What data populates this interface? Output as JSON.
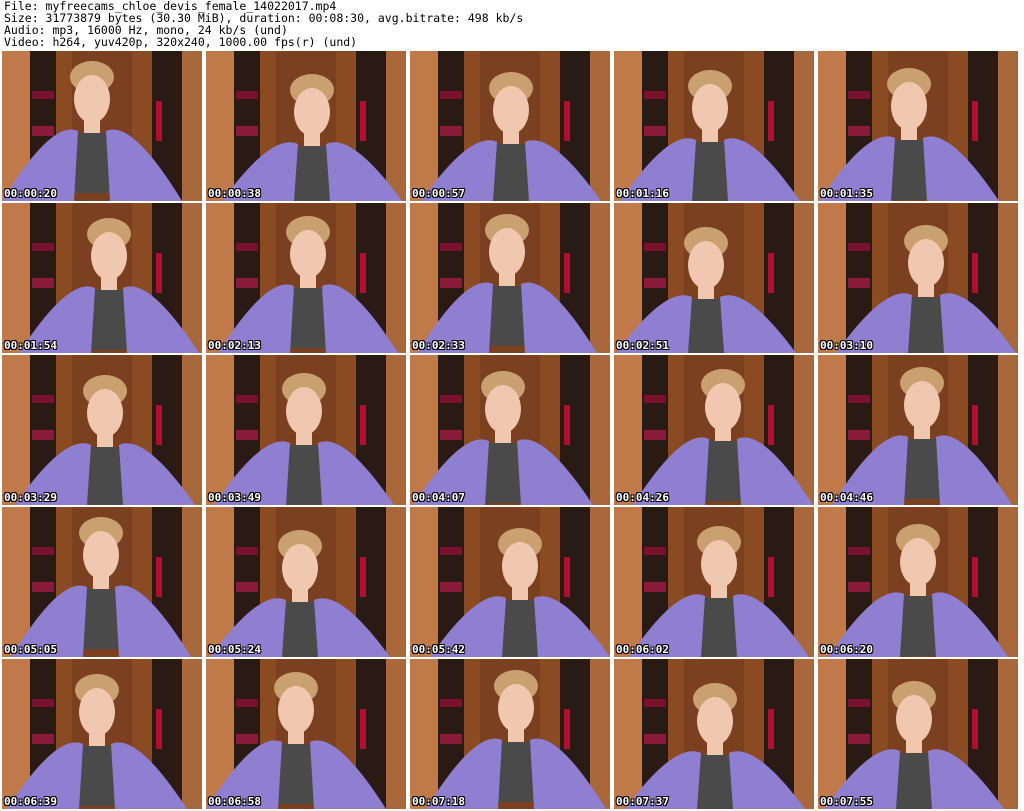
{
  "header": {
    "file": "File: myfreecams_chloe_devis_female_14022017.mp4",
    "size": "Size: 31773879 bytes (30.30 MiB), duration: 00:08:30, avg.bitrate: 498 kb/s",
    "audio": "Audio: mp3, 16000 Hz, mono, 24 kb/s (und)",
    "video": "Video: h264, yuv420p, 320x240, 1000.00 fps(r) (und)"
  },
  "thumbnails": [
    {
      "timestamp": "00:00:20"
    },
    {
      "timestamp": "00:00:38"
    },
    {
      "timestamp": "00:00:57"
    },
    {
      "timestamp": "00:01:16"
    },
    {
      "timestamp": "00:01:35"
    },
    {
      "timestamp": "00:01:54"
    },
    {
      "timestamp": "00:02:13"
    },
    {
      "timestamp": "00:02:33"
    },
    {
      "timestamp": "00:02:51"
    },
    {
      "timestamp": "00:03:10"
    },
    {
      "timestamp": "00:03:29"
    },
    {
      "timestamp": "00:03:49"
    },
    {
      "timestamp": "00:04:07"
    },
    {
      "timestamp": "00:04:26"
    },
    {
      "timestamp": "00:04:46"
    },
    {
      "timestamp": "00:05:05"
    },
    {
      "timestamp": "00:05:24"
    },
    {
      "timestamp": "00:05:42"
    },
    {
      "timestamp": "00:06:02"
    },
    {
      "timestamp": "00:06:20"
    },
    {
      "timestamp": "00:06:39"
    },
    {
      "timestamp": "00:06:58"
    },
    {
      "timestamp": "00:07:18"
    },
    {
      "timestamp": "00:07:37"
    },
    {
      "timestamp": "00:07:55"
    }
  ],
  "colors": {
    "background": "#ffffff",
    "wood": "#8a4a22",
    "shelf": "#2a1a14",
    "shawl": "#8f7fd0",
    "skin": "#f0c8b0",
    "hair": "#c9a070"
  }
}
